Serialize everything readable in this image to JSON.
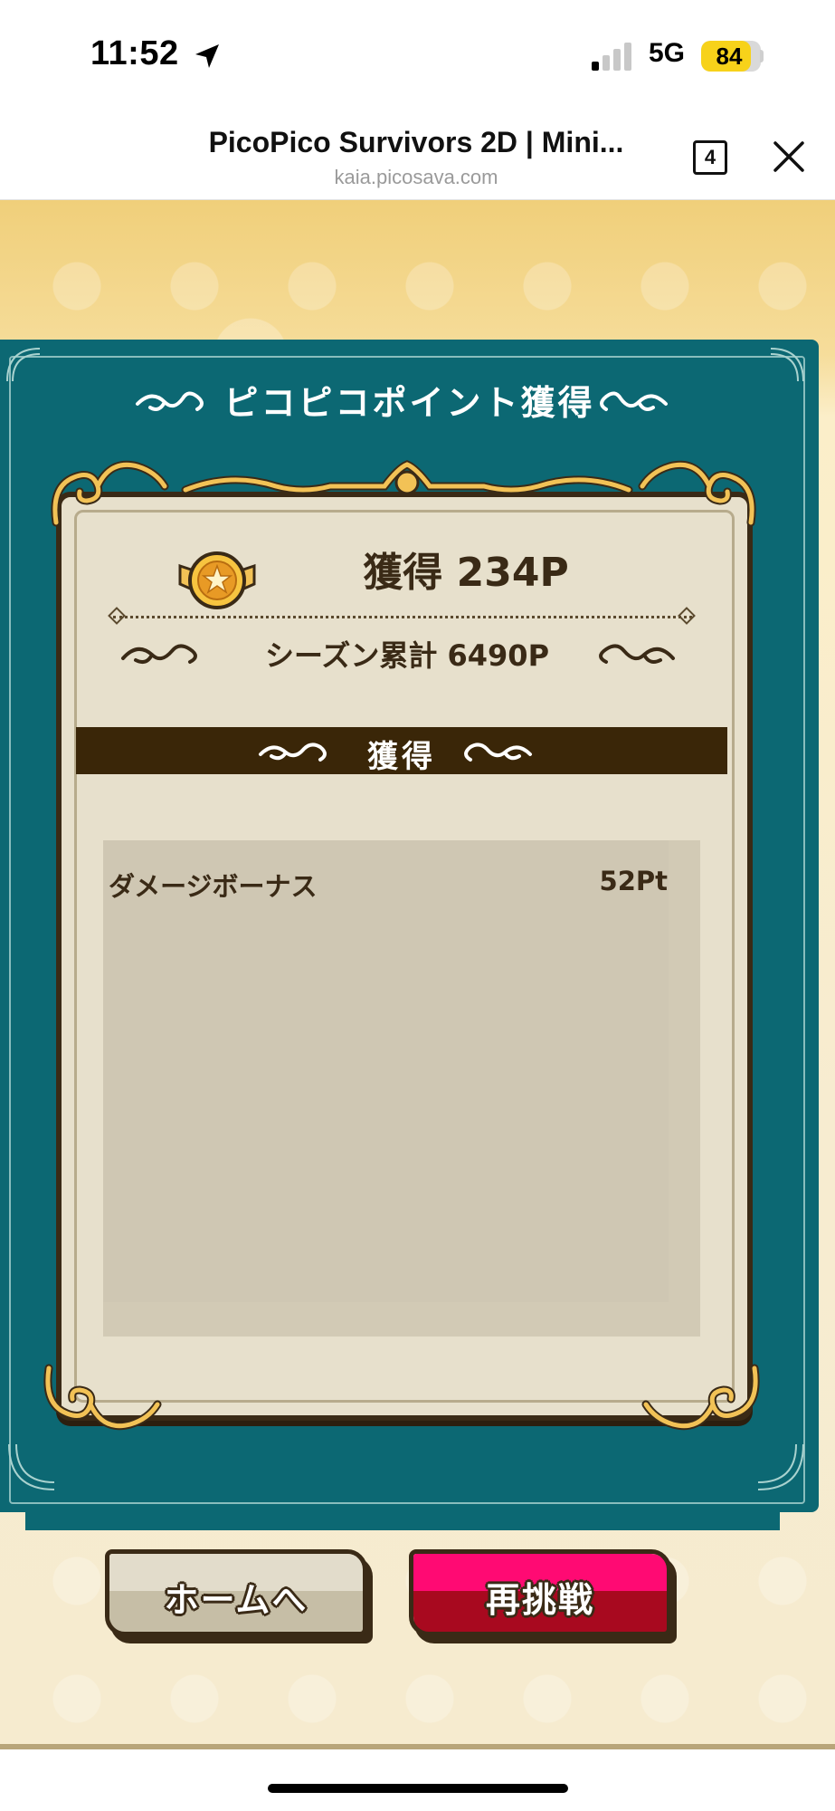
{
  "status_bar": {
    "time": "11:52",
    "network": "5G",
    "battery": "84",
    "battery_level": 0.84,
    "signal_bars_active": 1,
    "signal_bars_total": 4
  },
  "browser": {
    "title": "PicoPico Survivors 2D | Mini...",
    "url": "kaia.picosava.com",
    "tab_count": "4"
  },
  "result_panel": {
    "title": "ピコピコポイント獲得",
    "earned": "獲得 234P",
    "season_total": "シーズン累計 6490P",
    "section_label": "獲得",
    "items": [
      {
        "label": "ダメージボーナス",
        "value": "52Pt"
      }
    ]
  },
  "buttons": {
    "home": "ホームへ",
    "retry": "再挑戦"
  },
  "colors": {
    "panel_teal": "#0c6873",
    "card_bg": "#e7e0cc",
    "dark_brown": "#3a2a16",
    "retry_pink": "#ff0a73",
    "home_gray": "#d9d3c0"
  },
  "icons": [
    "location-arrow-icon",
    "signal-icon",
    "battery-icon",
    "tabs-icon",
    "close-icon",
    "medal-icon"
  ]
}
